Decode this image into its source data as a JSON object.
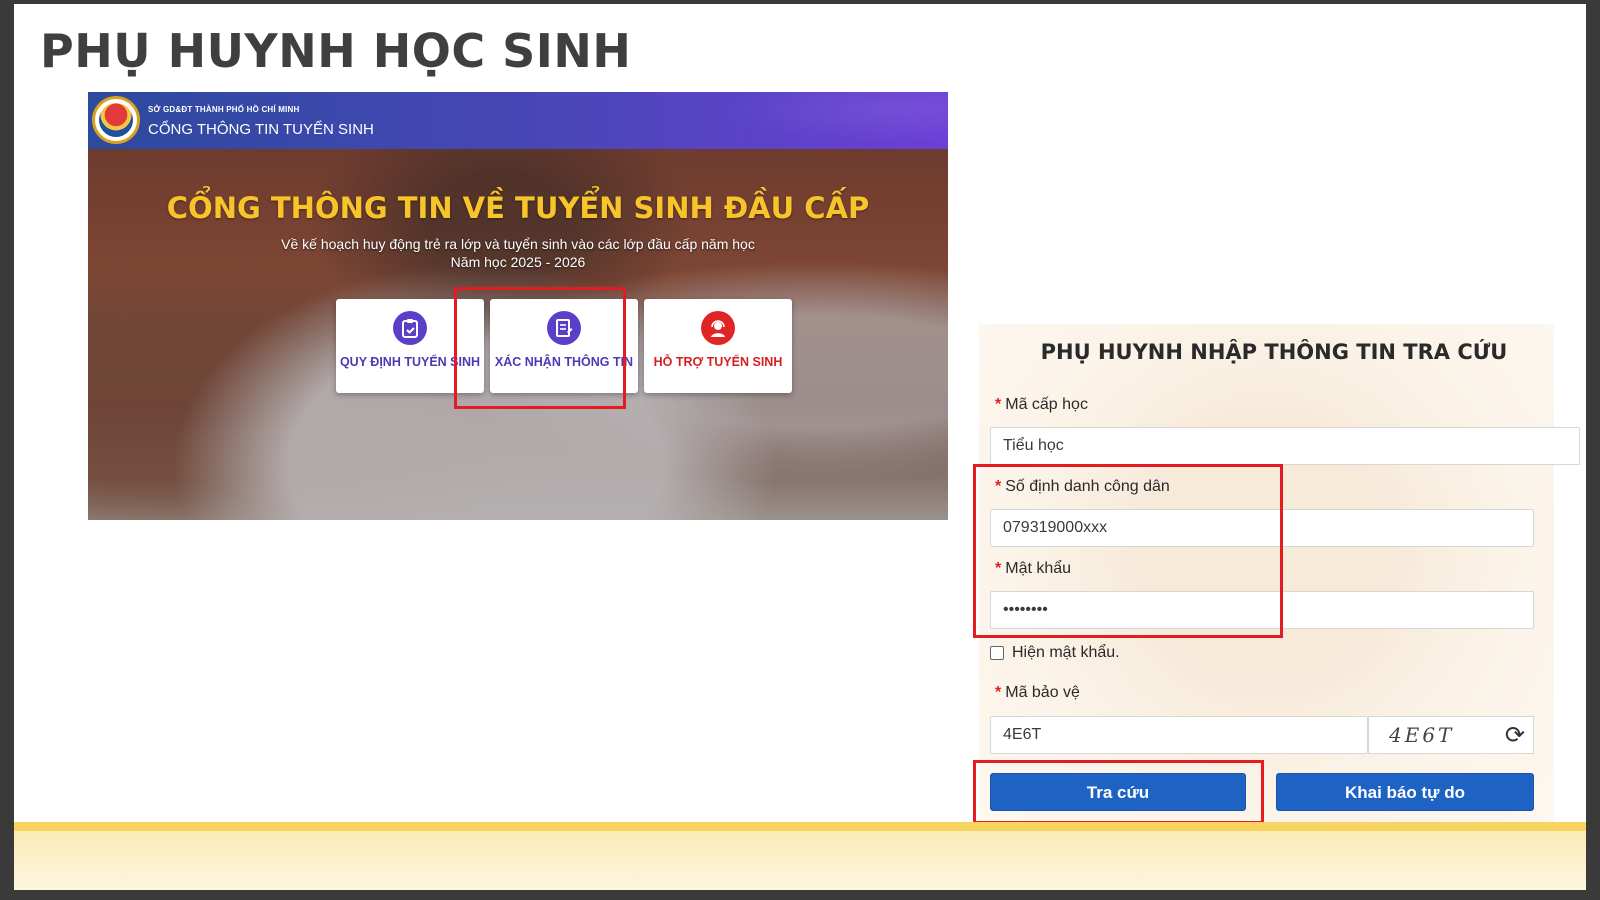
{
  "slide": {
    "title": "PHỤ HUYNH HỌC SINH"
  },
  "portal": {
    "header": {
      "org": "SỞ GD&ĐT THÀNH PHỐ HỒ CHÍ MINH",
      "name": "CỔNG THÔNG TIN TUYỂN SINH"
    },
    "hero": {
      "title": "CỔNG THÔNG TIN VỀ TUYỂN SINH ĐẦU CẤP",
      "line1": "Về kế hoạch huy động trẻ ra lớp và tuyển sinh vào các lớp đầu cấp năm học",
      "line2": "Năm học 2025 - 2026"
    },
    "cards": [
      {
        "label": "QUY ĐỊNH TUYỂN SINH",
        "icon": "clipboard-check-icon"
      },
      {
        "label": "XÁC NHẬN THÔNG TIN",
        "icon": "document-edit-icon"
      },
      {
        "label": "HỖ TRỢ TUYỂN SINH",
        "icon": "support-agent-icon"
      }
    ]
  },
  "form": {
    "title": "PHỤ HUYNH NHẬP THÔNG TIN TRA CỨU",
    "required_mark": "*",
    "level_label": "Mã cấp học",
    "level_value": "Tiểu học",
    "id_label": "Số định danh công dân",
    "id_value": "079319000xxx",
    "password_label": "Mật khẩu",
    "password_value": "••••••••",
    "show_password_label": "Hiện mật khẩu.",
    "captcha_label": "Mã bảo vệ",
    "captcha_value": "4E6T",
    "captcha_image_text": "4E6T",
    "search_button": "Tra cứu",
    "free_button": "Khai báo tự do"
  },
  "colors": {
    "highlight": "#e31b23",
    "button": "#1e63c4",
    "hero_title": "#f7c52a",
    "card_purple": "#5b3fc9",
    "card_red": "#e02525"
  }
}
